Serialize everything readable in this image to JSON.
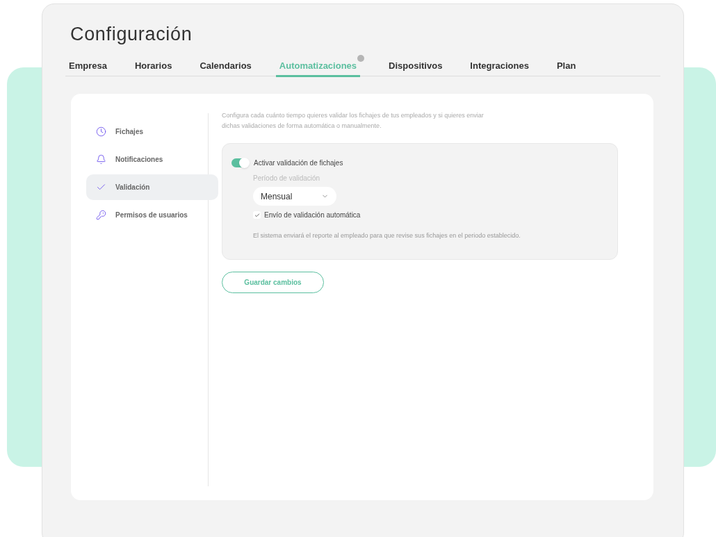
{
  "page": {
    "title": "Configuración"
  },
  "tabs": [
    {
      "label": "Empresa",
      "selected": false,
      "badge": false
    },
    {
      "label": "Horarios",
      "selected": false,
      "badge": false
    },
    {
      "label": "Calendarios",
      "selected": false,
      "badge": false
    },
    {
      "label": "Automatizaciones",
      "selected": true,
      "badge": true
    },
    {
      "label": "Dispositivos",
      "selected": false,
      "badge": false
    },
    {
      "label": "Integraciones",
      "selected": false,
      "badge": false
    },
    {
      "label": "Plan",
      "selected": false,
      "badge": false
    }
  ],
  "sidebar": {
    "items": [
      {
        "label": "Fichajes",
        "selected": false
      },
      {
        "label": "Notificaciones",
        "selected": false
      },
      {
        "label": "Validación",
        "selected": true
      },
      {
        "label": "Permisos de usuarios",
        "selected": false
      }
    ]
  },
  "content": {
    "description": "Configura cada cuánto tiempo quieres validar los fichajes de tus empleados y si quieres enviar dichas validaciones de forma automática o manualmente.",
    "toggle": {
      "label": "Activar validación de fichajes",
      "on": true
    },
    "period": {
      "label": "Período de validación",
      "value": "Mensual"
    },
    "auto_send": {
      "label": "Envío de validación automática",
      "checked": true
    },
    "note": "El sistema enviará el reporte al empleado para que revise sus fichajes en el periodo establecido."
  },
  "save_button": "Guardar cambios"
}
